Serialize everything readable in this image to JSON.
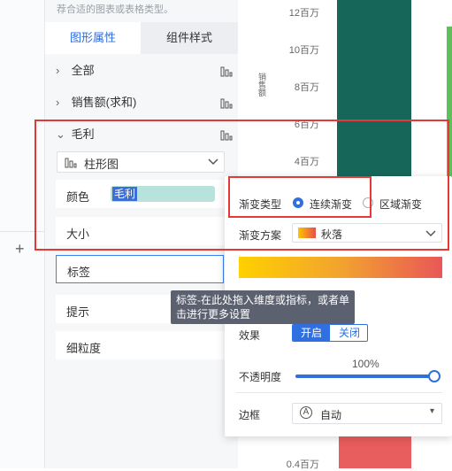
{
  "panel": {
    "hint": "荐合适的图表或表格类型。",
    "tabs": [
      "图形属性",
      "组件样式"
    ],
    "rows": {
      "all": "全部",
      "sales": "销售额(求和)",
      "profit": "毛利"
    },
    "chart_type": "柱形图",
    "encodings": {
      "color": "颜色",
      "color_field": "毛利",
      "size": "大小",
      "label": "标签",
      "tooltip": "提示",
      "granularity": "细粒度"
    }
  },
  "tooltip_text": "标签-在此处拖入维度或指标，或者单击进行更多设置",
  "chart": {
    "yticks": [
      "12百万",
      "10百万",
      "8百万",
      "6百万",
      "4百万",
      "0.4百万"
    ],
    "ylabel": "销售额"
  },
  "popup": {
    "gradient_type_label": "渐变类型",
    "gradient_options": [
      "连续渐变",
      "区域渐变"
    ],
    "scheme_label": "渐变方案",
    "scheme_value": "秋落",
    "effect_label": "效果",
    "effect_on": "开启",
    "effect_off": "关闭",
    "opacity_label": "不透明度",
    "opacity_value": "100%",
    "border_label": "边框",
    "border_value": "自动"
  },
  "colors": {
    "accent": "#2f6fe0",
    "bar_green": "#16675a",
    "bar_red": "#e85d5d",
    "annotation": "#e53935"
  }
}
